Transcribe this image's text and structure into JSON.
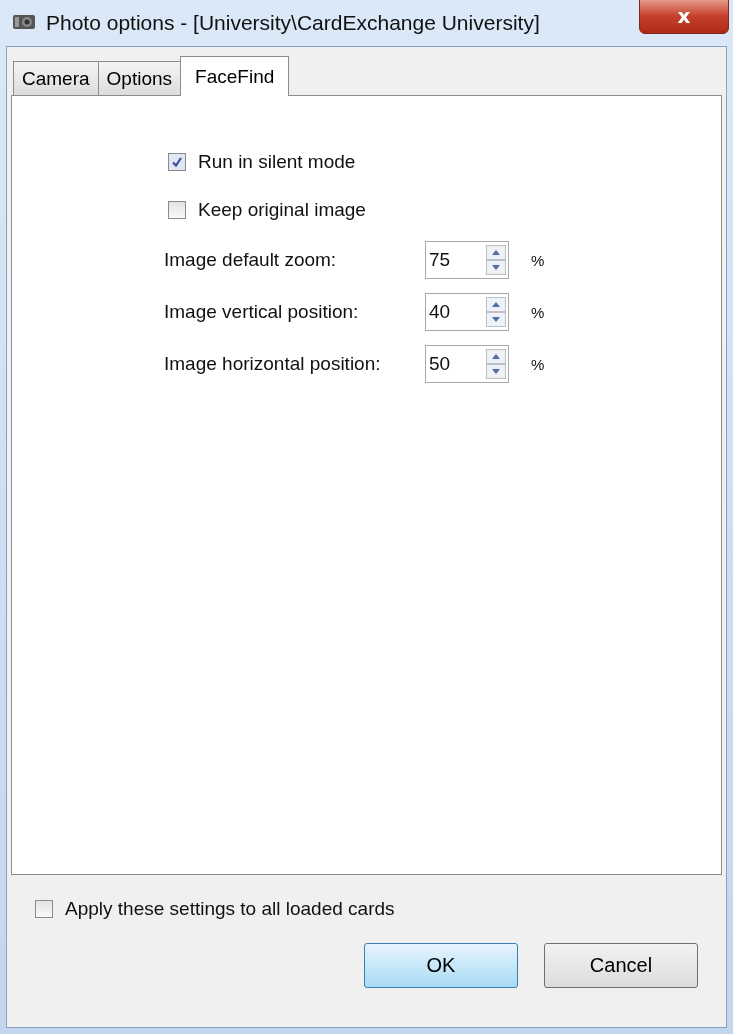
{
  "window": {
    "title": "Photo options - [University\\CardExchange University]",
    "close": "x"
  },
  "tabs": [
    {
      "label": "Camera",
      "selected": false
    },
    {
      "label": "Options",
      "selected": false
    },
    {
      "label": "FaceFind",
      "selected": true
    }
  ],
  "options": [
    {
      "kind": "checkbox",
      "label": "Run in silent mode",
      "checked": true
    },
    {
      "kind": "checkbox",
      "label": "Keep original image",
      "checked": false
    },
    {
      "kind": "spin",
      "label": "Image default zoom:",
      "value": "75",
      "unit": "%"
    },
    {
      "kind": "spin",
      "label": "Image vertical position:",
      "value": "40",
      "unit": "%"
    },
    {
      "kind": "spin",
      "label": "Image horizontal position:",
      "value": "50",
      "unit": "%"
    }
  ],
  "apply_all": {
    "label": "Apply these settings to all loaded cards",
    "checked": false
  },
  "buttons": [
    {
      "label": "OK",
      "default": true
    },
    {
      "label": "Cancel",
      "default": false
    }
  ]
}
